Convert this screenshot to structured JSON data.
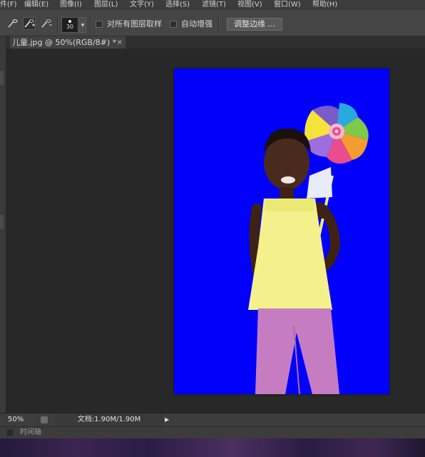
{
  "menu": [
    "件(F)",
    "编辑(E)",
    "图像(I)",
    "图层(L)",
    "文字(Y)",
    "选择(S)",
    "滤镜(T)",
    "视图(V)",
    "窗口(W)",
    "帮助(H)"
  ],
  "options": {
    "brush_size": "30",
    "sample_all_layers_label": "对所有图层取样",
    "auto_enhance_label": "自动增强",
    "refine_edge_label": "调整边缘 ..."
  },
  "document_tab": {
    "title": "儿童.jpg @ 50%(RGB/8#) *",
    "close": "×"
  },
  "canvas": {
    "background": "#0000fb"
  },
  "status": {
    "zoom": "50%",
    "doc_info": "文档:1.90M/1.90M"
  },
  "timeline_label": "时间轴"
}
